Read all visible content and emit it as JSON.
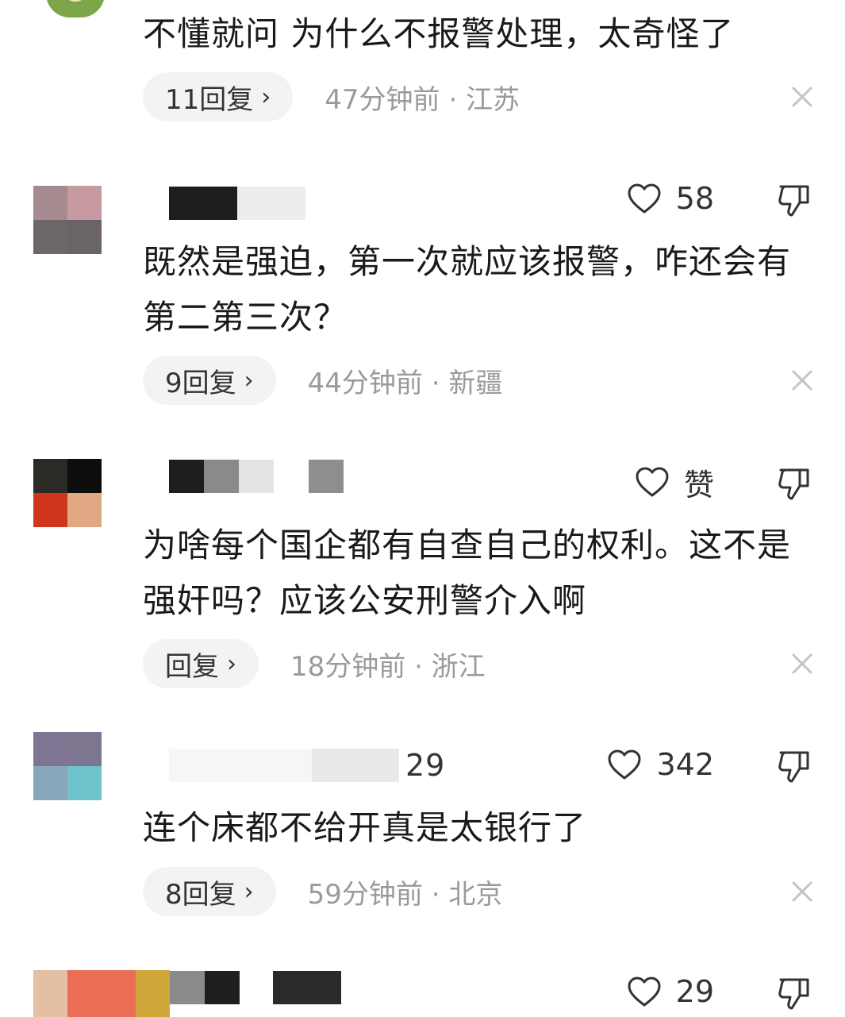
{
  "comments": [
    {
      "text": "不懂就问 为什么不报警处理，太奇怪了",
      "replies": "11回复",
      "time": "47分钟前 · 江苏"
    },
    {
      "likes": "58",
      "text": "既然是强迫，第一次就应该报警，咋还会有第二第三次？",
      "replies": "9回复",
      "time": "44分钟前 · 新疆"
    },
    {
      "likes": "赞",
      "text": "为啥每个国企都有自查自己的权利。这不是强奸吗？应该公安刑警介入啊",
      "replies": "回复",
      "time": "18分钟前 · 浙江"
    },
    {
      "username_tail": "29",
      "likes": "342",
      "text": "连个床都不给开真是太银行了",
      "replies": "8回复",
      "time": "59分钟前 · 北京"
    },
    {
      "likes": "29"
    }
  ],
  "reply_chevron": "›",
  "icons": {
    "like": "heart-outline-icon",
    "dislike": "thumbs-down-outline-icon",
    "close": "close-icon"
  },
  "colors": {
    "text": "#1a1a1a",
    "meta": "#9a9a9a",
    "pill": "#f3f3f3",
    "icon": "#333333",
    "close": "#c4c4c4"
  }
}
